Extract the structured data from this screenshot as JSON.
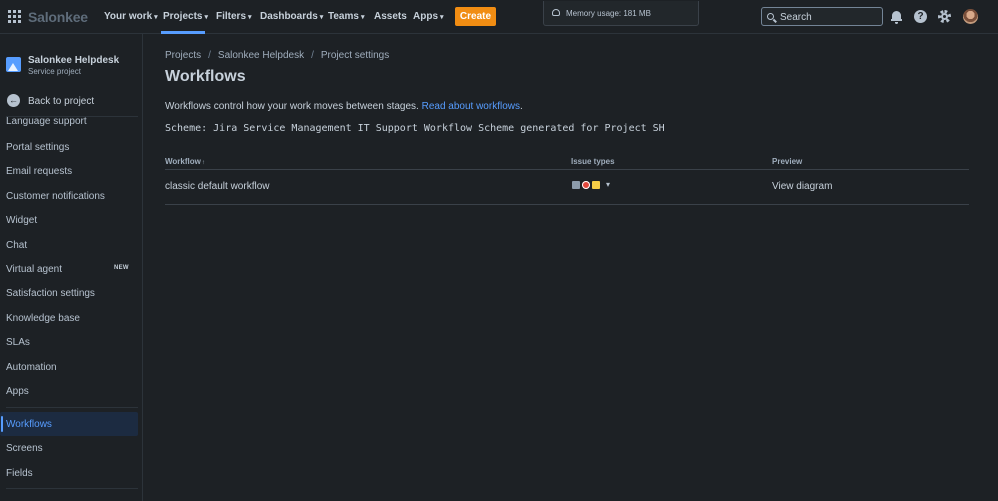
{
  "topnav": {
    "logo": "Salonkee",
    "items": [
      {
        "label": "Your work",
        "chevron": true
      },
      {
        "label": "Projects",
        "chevron": true
      },
      {
        "label": "Filters",
        "chevron": true
      },
      {
        "label": "Dashboards",
        "chevron": true
      },
      {
        "label": "Teams",
        "chevron": true
      },
      {
        "label": "Assets",
        "chevron": false
      },
      {
        "label": "Apps",
        "chevron": true
      }
    ],
    "create_label": "Create",
    "memory_usage": "Memory usage: 181 MB",
    "search_placeholder": "Search",
    "help_glyph": "?",
    "accent_color": "#579dff",
    "create_color": "#f18d13"
  },
  "sidebar": {
    "project_name": "Salonkee Helpdesk",
    "project_type": "Service project",
    "back_label": "Back to project",
    "back_glyph": "←",
    "items": [
      {
        "label": "Language support"
      },
      {
        "label": "Portal settings"
      },
      {
        "label": "Email requests"
      },
      {
        "label": "Customer notifications"
      },
      {
        "label": "Widget"
      },
      {
        "label": "Chat"
      },
      {
        "label": "Virtual agent",
        "badge": "NEW"
      },
      {
        "label": "Satisfaction settings"
      },
      {
        "label": "Knowledge base"
      },
      {
        "label": "SLAs"
      },
      {
        "label": "Automation"
      },
      {
        "label": "Apps"
      },
      {
        "label": "Workflows",
        "active": true
      },
      {
        "label": "Screens"
      },
      {
        "label": "Fields"
      }
    ]
  },
  "main": {
    "breadcrumbs": [
      "Projects",
      "Salonkee Helpdesk",
      "Project settings"
    ],
    "title": "Workflows",
    "description": "Workflows control how your work moves between stages.",
    "description_link": "Read about workflows",
    "description_end": ".",
    "scheme": "Scheme: Jira Service Management IT Support Workflow Scheme generated for Project SH",
    "table": {
      "headers": {
        "workflow": "Workflow",
        "issue_types": "Issue types",
        "preview": "Preview"
      },
      "sort_glyph": "↑",
      "rows": [
        {
          "workflow": "classic default workflow",
          "issue_type_icons": [
            "task-icon",
            "bug-icon",
            "story-icon"
          ],
          "preview": "View diagram"
        }
      ]
    }
  }
}
